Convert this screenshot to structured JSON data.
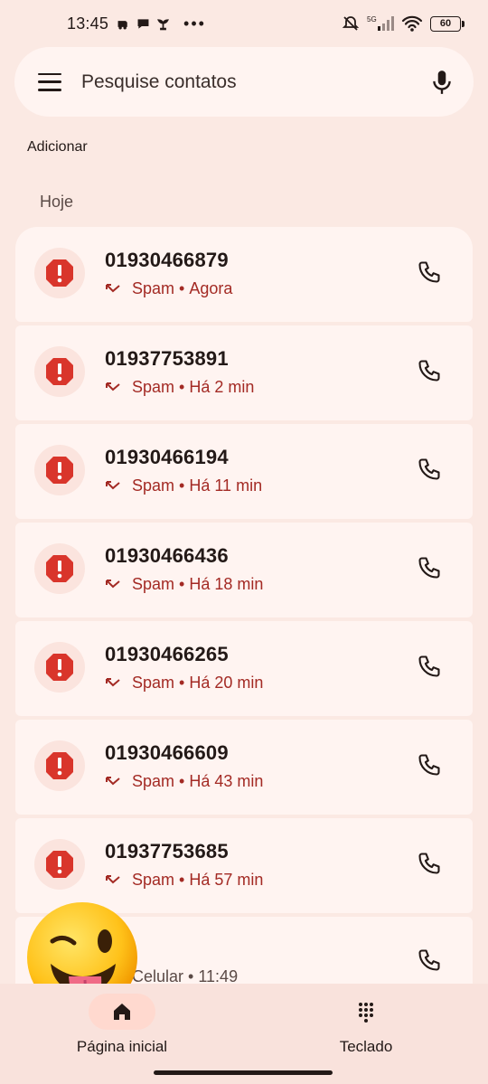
{
  "status_bar": {
    "time": "13:45",
    "network": "5G",
    "battery": "60"
  },
  "search": {
    "placeholder": "Pesquise contatos"
  },
  "add_label": "Adicionar",
  "section_today": "Hoje",
  "calls": [
    {
      "number": "01930466879",
      "tag": "Spam",
      "time": "Agora"
    },
    {
      "number": "01937753891",
      "tag": "Spam",
      "time": "Há 2 min"
    },
    {
      "number": "01930466194",
      "tag": "Spam",
      "time": "Há 11 min"
    },
    {
      "number": "01930466436",
      "tag": "Spam",
      "time": "Há 18 min"
    },
    {
      "number": "01930466265",
      "tag": "Spam",
      "time": "Há 20 min"
    },
    {
      "number": "01930466609",
      "tag": "Spam",
      "time": "Há 43 min"
    },
    {
      "number": "01937753685",
      "tag": "Spam",
      "time": "Há 57 min"
    }
  ],
  "partial_call": {
    "type": "Celular",
    "time": "11:49"
  },
  "separator": "•",
  "nav": {
    "home_label": "Página inicial",
    "keypad_label": "Teclado"
  },
  "colors": {
    "background": "#fbe9e3",
    "card": "#fff4f1",
    "spam_red": "#a32a24",
    "alert_red": "#d9352b"
  }
}
